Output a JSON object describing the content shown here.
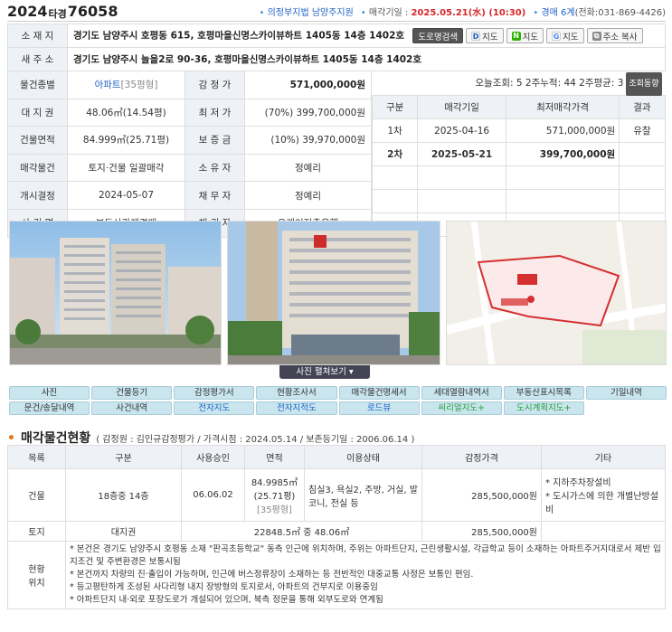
{
  "header": {
    "case_year": "2024",
    "case_ta": "타경",
    "case_num": "76058",
    "court": "의정부지법 남양주지원",
    "sale_label": "매각기일 :",
    "sale_date": "2025.05.21(水) (10:30)",
    "dept": "경매 6계",
    "tel": "(전화:031-869-4426)"
  },
  "info": {
    "address_label": "소 재 지",
    "address": "경기도 남양주시 호평동 615, 호평마을신명스카이뷰하트 1405동 14층 1402호",
    "road_btn": "도로명검색",
    "map_d": "지도",
    "map_n": "지도",
    "map_g": "지도",
    "copy_btn": "주소 복사",
    "new_addr_label": "새 주 소",
    "new_addr": "경기도 남양주시 늘을2로 90-36, 호평마을신명스카이뷰하트 1405동 14층 1402호",
    "type_label": "물건종별",
    "type_value": "아파트",
    "type_sub": "[35평형]",
    "appraisal_label": "감 정 가",
    "appraisal": "571,000,000원",
    "views": "오늘조회: 5  2주누적: 44  2주평균: 3",
    "views_btn": "조회동향",
    "land_label": "대 지 권",
    "land": "48.06㎡(14.54평)",
    "min_label": "최 저 가",
    "min": "(70%) 399,700,000원",
    "area_label": "건물면적",
    "area": "84.999㎡(25.71평)",
    "deposit_label": "보 증 금",
    "deposit": "(10%) 39,970,000원",
    "sale_obj_label": "매각물건",
    "sale_obj": "토지·건물 일괄매각",
    "owner_label": "소 유 자",
    "owner": "정예리",
    "start_label": "개시결정",
    "start": "2024-05-07",
    "debtor_label": "채 무 자",
    "debtor": "정예리",
    "case_name_label": "사 건 명",
    "case_name": "부동산강제경매",
    "creditor_label": "채 권 자",
    "creditor": "오케이저축은행"
  },
  "history": {
    "headers": [
      "구분",
      "매각기일",
      "최저매각가격",
      "결과"
    ],
    "rows": [
      {
        "no": "1차",
        "date": "2025-04-16",
        "price": "571,000,000원",
        "result": "유찰"
      },
      {
        "no": "2차",
        "date": "2025-05-21",
        "price": "399,700,000원",
        "result": ""
      }
    ]
  },
  "photo_caption": "사진 펼쳐보기",
  "tabs": [
    "사진",
    "건물등기",
    "감정평가서",
    "현황조사서",
    "매각물건명세서",
    "세대열람내역서",
    "부동산표시목록",
    "기일내역",
    "문건/송달내역",
    "사건내역",
    "전자지도",
    "전자지적도",
    "로드뷰",
    "씨리얼지도+",
    "도시계획지도+"
  ],
  "section": {
    "title": "매각물건현황",
    "meta": "( 감정원 : 김인규감정평가 / 가격시점 : 2024.05.14 / 보존등기일 : 2006.06.14 )"
  },
  "items": {
    "headers": [
      "목록",
      "구분",
      "사용승인",
      "면적",
      "이용상태",
      "감정가격",
      "기타"
    ],
    "building": {
      "label": "건물",
      "kind": "18층중 14층",
      "approved": "06.06.02",
      "area1": "84.9985㎡",
      "area2": "(25.71평)",
      "area3": "[35평형]",
      "status": "침실3, 욕실2, 주방, 거실, 발코니, 전실 등",
      "price": "285,500,000원",
      "etc1": "* 지하주차장설비",
      "etc2": "* 도시가스에 의한 개별난방설비"
    },
    "land": {
      "label": "토지",
      "kind": "대지권",
      "area": "22848.5㎡ 중 48.06㎡",
      "price": "285,500,000원"
    },
    "loc_label1": "현황",
    "loc_label2": "위치",
    "loc_lines": [
      "* 본건은 경기도 남양주시 호평동 소재 \"판곡초등학교\" 동측 인근에 위치하며, 주위는 아파트단지, 근린생활시설, 각급학교 등이 소재하는 아파트주거지대로서 제반 입지조건 및 주변환경은 보통시됨",
      "* 본건까지 차량의 진·출입이 가능하며, 인근에 버스정류장이 소재하는 등 전반적인 대중교통 사정은 보통인 편임.",
      "* 등고평탄하게 조성된 사다리형 내지 장방형의 토지로서, 아파트의 건부지로 이용중임",
      "* 아파트단지 내·외로 포장도로가 개설되어 있으며, 북측 정문을 통해 외부도로와 연계됨"
    ]
  },
  "colors": {
    "accent": "#1d61c7",
    "red": "#d42a2a",
    "tab_bg": "#c9e5ee",
    "header_bg": "#eef2f6"
  }
}
